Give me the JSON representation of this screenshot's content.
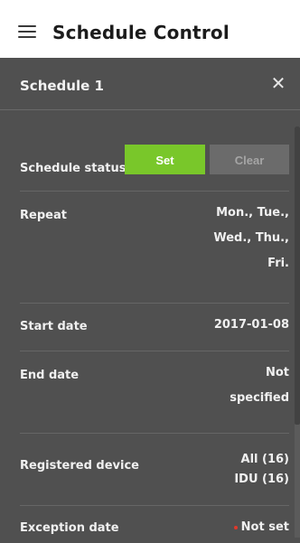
{
  "header": {
    "title": "Schedule Control",
    "menu_icon": "hamburger-menu-icon"
  },
  "panel": {
    "title": "Schedule 1",
    "close_icon": "close-icon",
    "close_glyph": "✕"
  },
  "schedule_status": {
    "label": "Schedule status",
    "set_label": "Set",
    "clear_label": "Clear",
    "active": "Set",
    "active_color": "#79c72a"
  },
  "repeat": {
    "label": "Repeat",
    "lines": [
      "Mon., Tue.,",
      "Wed., Thu.,",
      "Fri."
    ]
  },
  "start_date": {
    "label": "Start date",
    "value": "2017-01-08"
  },
  "end_date": {
    "label": "End date",
    "lines": [
      "Not",
      "specified"
    ]
  },
  "registered_device": {
    "label": "Registered device",
    "lines": [
      "All (16)",
      "IDU (16)"
    ]
  },
  "exception_date": {
    "label": "Exception date",
    "value": "Not set",
    "indicator_color": "#e0392b"
  }
}
